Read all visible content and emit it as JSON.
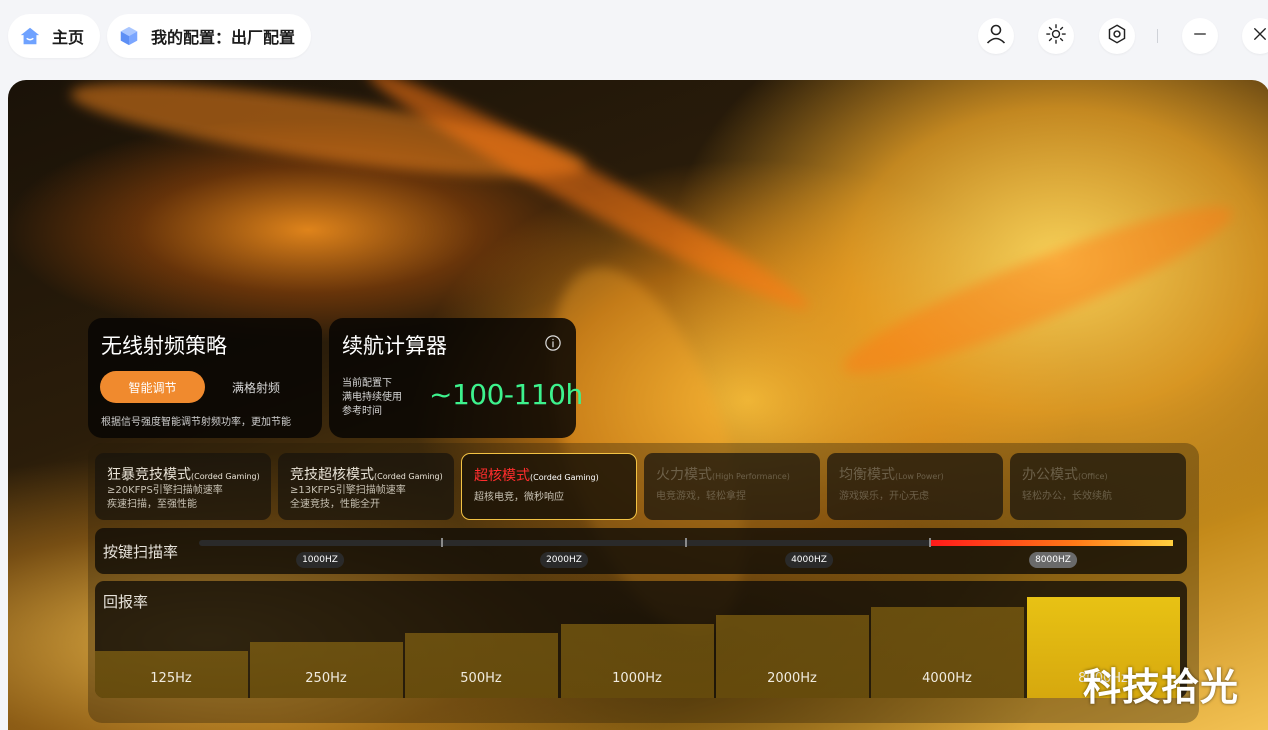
{
  "nav": {
    "home_label": "主页",
    "config_label": "我的配置：出厂配置"
  },
  "window": {
    "icons": [
      "user-icon",
      "brightness-icon",
      "settings-icon",
      "minimize-icon",
      "close-icon"
    ]
  },
  "rf_strategy": {
    "title": "无线射频策略",
    "option_active": "智能调节",
    "option_inactive": "满格射频",
    "description": "根据信号强度智能调节射频功率，更加节能"
  },
  "battery": {
    "title": "续航计算器",
    "caption_lines": [
      "当前配置下",
      "满电持续使用",
      "参考时间"
    ],
    "value": "~100-110h"
  },
  "modes": [
    {
      "zh": "狂暴竞技模式",
      "en": "(Corded Gaming)",
      "line1": "≥20KFPS引擎扫描帧速率",
      "line2": "疾速扫描，至强性能",
      "state": "normal"
    },
    {
      "zh": "竞技超核模式",
      "en": "(Corded Gaming)",
      "line1": "≥13KFPS引擎扫描帧速率",
      "line2": "全速竞技，性能全开",
      "state": "normal"
    },
    {
      "zh": "超核模式",
      "en": "(Corded Gaming)",
      "line1": "超核电竞，微秒响应",
      "line2": "",
      "state": "active"
    },
    {
      "zh": "火力模式",
      "en": "(High Performance)",
      "line1": "电竞游戏，轻松拿捏",
      "line2": "",
      "state": "dim"
    },
    {
      "zh": "均衡模式",
      "en": "(Low Power)",
      "line1": "游戏娱乐，开心无虑",
      "line2": "",
      "state": "dim"
    },
    {
      "zh": "办公模式",
      "en": "(Office)",
      "line1": "轻松办公，长效续航",
      "line2": "",
      "state": "dim"
    }
  ],
  "scan_rate": {
    "label": "按键扫描率",
    "options": [
      "1000HZ",
      "2000HZ",
      "4000HZ",
      "8000HZ"
    ],
    "selected_index": 3
  },
  "report_rate": {
    "label": "回报率",
    "options": [
      "125Hz",
      "250Hz",
      "500Hz",
      "1000Hz",
      "2000Hz",
      "4000Hz",
      "8000Hz"
    ],
    "selected_index": 6
  },
  "watermark": "科技拾光",
  "colors": {
    "accent_orange": "#f08a2e",
    "battery_green": "#3df28d",
    "active_mode_red": "#ff2d2d",
    "active_border_gold": "#f2c244"
  }
}
